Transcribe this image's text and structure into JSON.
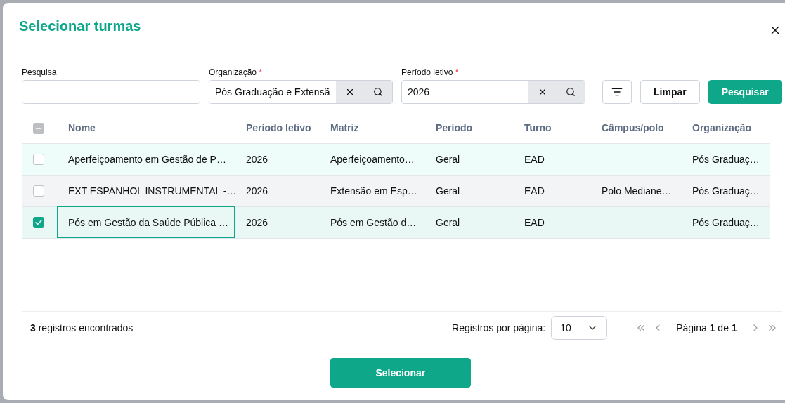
{
  "dialog": {
    "title": "Selecionar turmas"
  },
  "filters": [
    {
      "kind": "text",
      "label": "Pesquisa"
    },
    {
      "kind": "lookup",
      "label": "Organização",
      "required_mark": "*",
      "value": "Pós Graduação e Extensã"
    },
    {
      "kind": "lookup",
      "label": "Período letivo",
      "required_mark": "*",
      "value": "2026"
    }
  ],
  "buttons": [
    {
      "kind": "icon"
    },
    {
      "kind": "outline",
      "label": "Limpar"
    },
    {
      "kind": "primary",
      "label": "Pesquisar"
    }
  ],
  "table": {
    "select_all_partial": true,
    "columns": [
      "Nome",
      "Período letivo",
      "Matriz",
      "Período",
      "Turno",
      "Câmpus/polo",
      "Organização"
    ],
    "rows": [
      {
        "checked": false,
        "focused": false,
        "cells": [
          "Aperfeiçoamento em Gestão de P…",
          "2026",
          "Aperfeiçoamento…",
          "Geral",
          "EAD",
          "",
          "Pós Graduaç…"
        ]
      },
      {
        "checked": false,
        "focused": false,
        "cells": [
          "EXT ESPANHOL INSTRUMENTAL -…",
          "2026",
          "Extensão em Esp…",
          "Geral",
          "EAD",
          "Polo Mediane…",
          "Pós Graduaç…"
        ]
      },
      {
        "checked": true,
        "focused": true,
        "cells": [
          "Pós em Gestão da Saúde Pública …",
          "2026",
          "Pós em Gestão d…",
          "Geral",
          "EAD",
          "",
          "Pós Graduaç…"
        ]
      }
    ]
  },
  "footer": {
    "count": "**3** registros encontrados",
    "per_page_label": "Registros por página:",
    "per_page": "10",
    "page": "Página **1** de **1**"
  },
  "confirm_button": "Selecionar"
}
